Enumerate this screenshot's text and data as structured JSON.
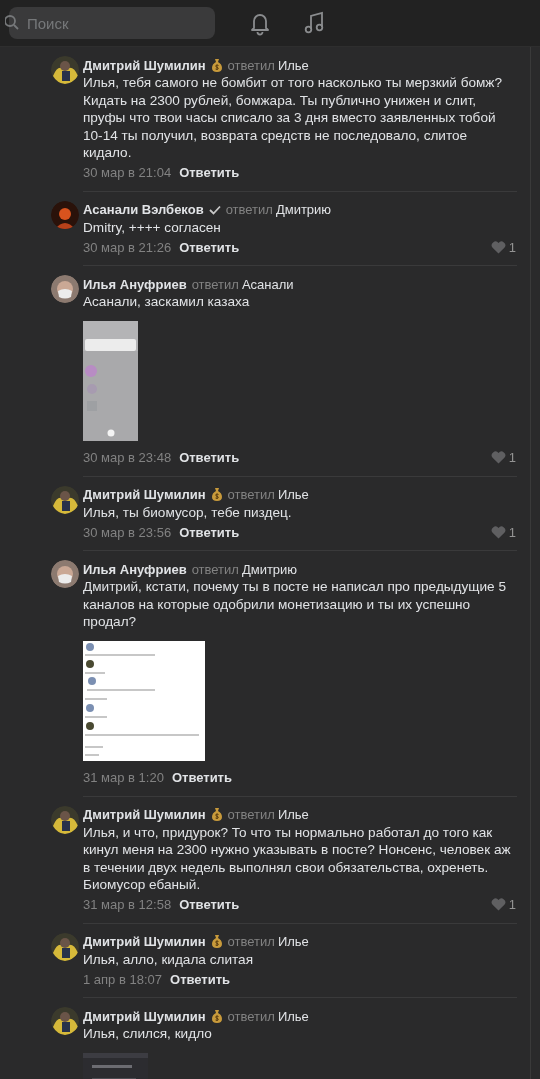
{
  "header": {
    "search": {
      "placeholder": "Поиск"
    }
  },
  "comments": [
    {
      "author": "Дмитрий Шумилин",
      "avatar": {
        "kind": "yellow"
      },
      "badge": {
        "kind": "money"
      },
      "replied": "ответил",
      "reply_to": "Илье",
      "text": "Илья, тебя самого не бомбит от того насколько ты мерзкий бомж? Кидать на 2300 рублей, бомжара. Ты публично унижен и слит, пруфы что твои часы списало за 3 дня вместо заявленных тобой 10-14 ты получил, возврата средств не последовало, слитое кидало.",
      "date": "30 мар в 21:04",
      "reply_label": "Ответить"
    },
    {
      "author": "Асанали Вэлбеков",
      "avatar": {
        "kind": "orange"
      },
      "badge": {
        "kind": "verified"
      },
      "replied": "ответил",
      "reply_to": "Дмитрию",
      "text": "Dmitry, ++++ согласен",
      "date": "30 мар в 21:26",
      "reply_label": "Ответить",
      "likes": "1"
    },
    {
      "author": "Илья Ануфриев",
      "avatar": {
        "kind": "mask"
      },
      "replied": "ответил",
      "reply_to": "Асанали",
      "text": "Асанали, заскамил казаха",
      "attachment": {
        "kind": "phone"
      },
      "date": "30 мар в 23:48",
      "reply_label": "Ответить",
      "likes": "1"
    },
    {
      "author": "Дмитрий Шумилин",
      "avatar": {
        "kind": "yellow"
      },
      "badge": {
        "kind": "money"
      },
      "replied": "ответил",
      "reply_to": "Илье",
      "text": "Илья, ты биомусор, тебе пиздец.",
      "date": "30 мар в 23:56",
      "reply_label": "Ответить",
      "likes": "1"
    },
    {
      "author": "Илья Ануфриев",
      "avatar": {
        "kind": "mask"
      },
      "replied": "ответил",
      "reply_to": "Дмитрию",
      "text": "Дмитрий, кстати, почему ты в посте не написал про предыдущие 5 каналов на которые одобрили монетизацию и ты их успешно продал?",
      "attachment": {
        "kind": "chat"
      },
      "date": "31 мар в 1:20",
      "reply_label": "Ответить"
    },
    {
      "author": "Дмитрий Шумилин",
      "avatar": {
        "kind": "yellow"
      },
      "badge": {
        "kind": "money"
      },
      "replied": "ответил",
      "reply_to": "Илье",
      "text": "Илья, и что, придурок? То что ты нормально работал до того как кинул меня на 2300 нужно указывать в посте? Нонсенс, человек аж в течении двух недель выполнял свои обязательства, охренеть. Биомусор ебаный.",
      "date": "31 мар в 12:58",
      "reply_label": "Ответить",
      "likes": "1"
    },
    {
      "author": "Дмитрий Шумилин",
      "avatar": {
        "kind": "yellow"
      },
      "badge": {
        "kind": "money"
      },
      "replied": "ответил",
      "reply_to": "Илье",
      "text": "Илья, алло, кидала слитая",
      "date": "1 апр в 18:07",
      "reply_label": "Ответить"
    },
    {
      "author": "Дмитрий Шумилин",
      "avatar": {
        "kind": "yellow"
      },
      "badge": {
        "kind": "money"
      },
      "replied": "ответил",
      "reply_to": "Илье",
      "text": "Илья, слился, кидло",
      "attachment": {
        "kind": "document"
      }
    }
  ]
}
